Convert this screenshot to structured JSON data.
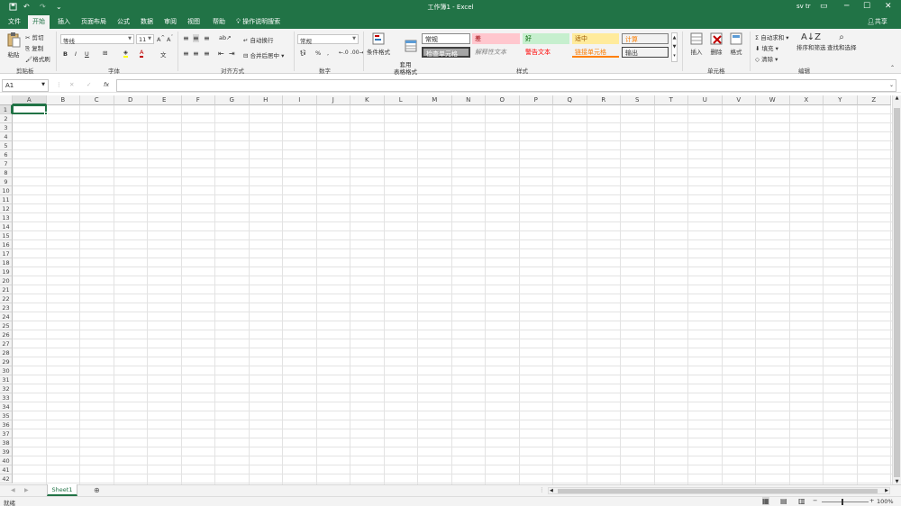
{
  "app": {
    "title": "工作簿1  -  Excel",
    "user": "sv tr"
  },
  "tabs": [
    "文件",
    "开始",
    "插入",
    "页面布局",
    "公式",
    "数据",
    "审阅",
    "视图",
    "帮助"
  ],
  "tell_me": "操作说明搜索",
  "share": "共享",
  "ribbon": {
    "clipboard": {
      "paste": "粘贴",
      "cut": "剪切",
      "copy": "复制",
      "format_painter": "格式刷",
      "label": "剪贴板"
    },
    "font": {
      "name": "等线",
      "size": "11",
      "label": "字体"
    },
    "alignment": {
      "wrap": "自动换行",
      "merge": "合并后居中",
      "label": "对齐方式"
    },
    "number": {
      "format": "常规",
      "percent": "%",
      "comma": ",",
      "label": "数字"
    },
    "styles": {
      "conditional": "条件格式",
      "table_format": "套用\n表格格式",
      "cells": [
        "常规",
        "差",
        "好",
        "适中",
        "计算",
        "检查单元格",
        "解释性文本",
        "警告文本",
        "链接单元格",
        "输出"
      ],
      "label": "样式"
    },
    "cells_group": {
      "insert": "插入",
      "delete": "删除",
      "format": "格式",
      "label": "单元格"
    },
    "editing": {
      "autosum": "自动求和",
      "fill": "填充",
      "clear": "清除",
      "sort": "排序和筛选",
      "find": "查找和选择",
      "label": "编辑"
    }
  },
  "formula_bar": {
    "name_box": "A1",
    "fx": "fx",
    "cancel": "✕",
    "enter": "✓",
    "value": ""
  },
  "columns": [
    "A",
    "B",
    "C",
    "D",
    "E",
    "F",
    "G",
    "H",
    "I",
    "J",
    "K",
    "L",
    "M",
    "N",
    "O",
    "P",
    "Q",
    "R",
    "S",
    "T",
    "U",
    "V",
    "W",
    "X",
    "Y",
    "Z"
  ],
  "rows": [
    "1",
    "2",
    "3",
    "4",
    "5",
    "6",
    "7",
    "8",
    "9",
    "10",
    "11",
    "12",
    "13",
    "14",
    "15",
    "16",
    "17",
    "18",
    "19",
    "20",
    "21",
    "22",
    "23",
    "24",
    "25",
    "26",
    "27",
    "28",
    "29",
    "30",
    "31",
    "32",
    "33",
    "34",
    "35",
    "36",
    "37",
    "38",
    "39",
    "40",
    "41",
    "42"
  ],
  "sheets": [
    "Sheet1"
  ],
  "status": {
    "ready": "就绪",
    "zoom": "100%"
  },
  "colors": {
    "accent": "#217346"
  }
}
